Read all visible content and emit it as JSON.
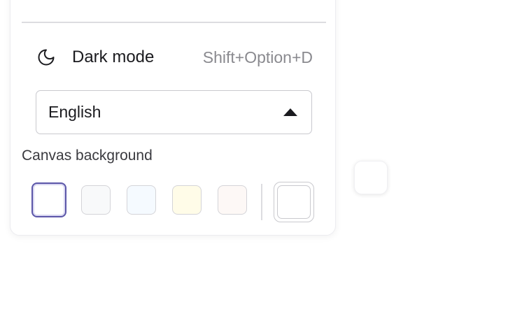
{
  "menu": {
    "dark_mode": {
      "label": "Dark mode",
      "shortcut": "Shift+Option+D",
      "icon": "moon-icon"
    },
    "language": {
      "selected": "English",
      "icon": "caret-up-icon"
    },
    "canvas_background": {
      "label": "Canvas background",
      "swatches": [
        {
          "color": "#ffffff",
          "selected": true
        },
        {
          "color": "#f8f9fa",
          "selected": false
        },
        {
          "color": "#f5faff",
          "selected": false
        },
        {
          "color": "#fffce8",
          "selected": false
        },
        {
          "color": "#fdf8f6",
          "selected": false
        }
      ],
      "custom_color": "#ffffff"
    }
  },
  "colors": {
    "accent": "#5b56a8",
    "text": "#1b1b1f",
    "muted": "#8a8a8f"
  }
}
